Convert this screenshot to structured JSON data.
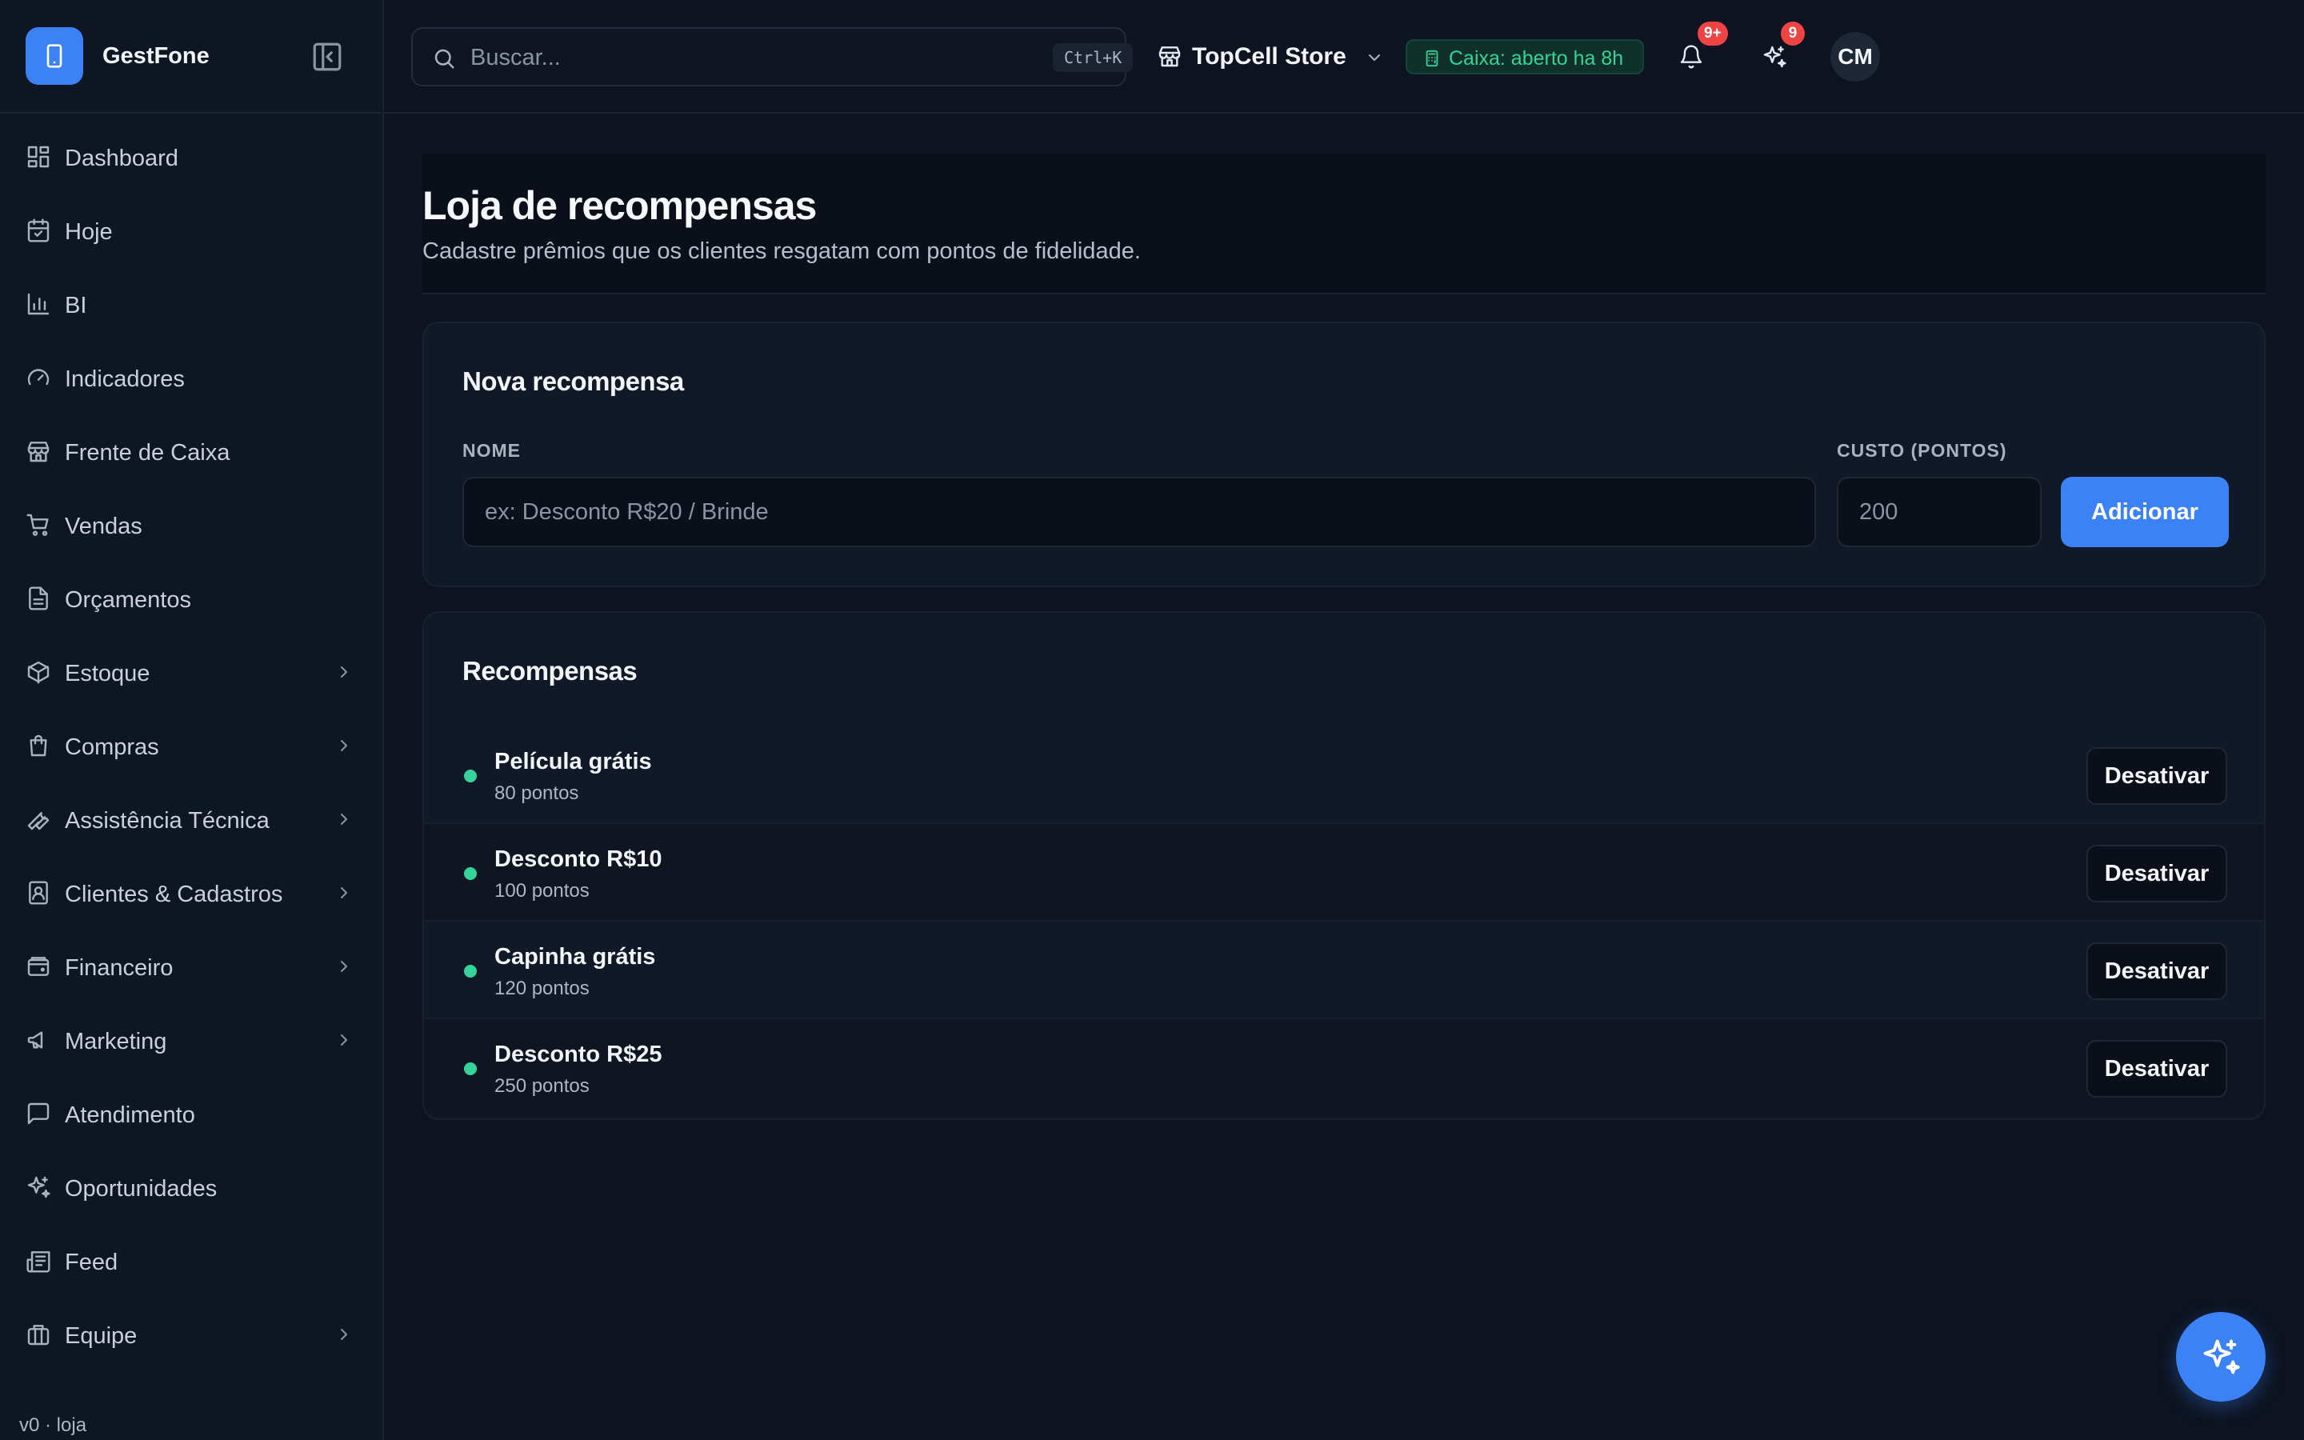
{
  "app": {
    "name": "GestFone",
    "version": "v0 · loja"
  },
  "sidebar": {
    "items": [
      {
        "label": "Dashboard",
        "icon": "dashboard-icon",
        "has_children": false
      },
      {
        "label": "Hoje",
        "icon": "calendar-icon",
        "has_children": false
      },
      {
        "label": "BI",
        "icon": "bar-chart-icon",
        "has_children": false
      },
      {
        "label": "Indicadores",
        "icon": "gauge-icon",
        "has_children": false
      },
      {
        "label": "Frente de Caixa",
        "icon": "store-icon",
        "has_children": false
      },
      {
        "label": "Vendas",
        "icon": "cart-icon",
        "has_children": false
      },
      {
        "label": "Orçamentos",
        "icon": "document-icon",
        "has_children": false
      },
      {
        "label": "Estoque",
        "icon": "package-icon",
        "has_children": true
      },
      {
        "label": "Compras",
        "icon": "shopping-bag-icon",
        "has_children": true
      },
      {
        "label": "Assistência Técnica",
        "icon": "wrench-icon",
        "has_children": true
      },
      {
        "label": "Clientes & Cadastros",
        "icon": "contact-book-icon",
        "has_children": true
      },
      {
        "label": "Financeiro",
        "icon": "wallet-icon",
        "has_children": true
      },
      {
        "label": "Marketing",
        "icon": "megaphone-icon",
        "has_children": true
      },
      {
        "label": "Atendimento",
        "icon": "chat-icon",
        "has_children": false
      },
      {
        "label": "Oportunidades",
        "icon": "sparkles-icon",
        "has_children": false
      },
      {
        "label": "Feed",
        "icon": "newspaper-icon",
        "has_children": false
      },
      {
        "label": "Equipe",
        "icon": "briefcase-icon",
        "has_children": true
      }
    ]
  },
  "topbar": {
    "search_placeholder": "Buscar...",
    "search_shortcut": "Ctrl+K",
    "store_name": "TopCell Store",
    "cash_status": "Caixa: aberto ha 8h",
    "notifications_badge": "9+",
    "ai_badge": "9",
    "user_initials": "CM"
  },
  "page": {
    "title": "Loja de recompensas",
    "subtitle": "Cadastre prêmios que os clientes resgatam com pontos de fidelidade."
  },
  "new_reward": {
    "title": "Nova recompensa",
    "name_label": "NOME",
    "name_placeholder": "ex: Desconto R$20 / Brinde",
    "cost_label": "CUSTO (PONTOS)",
    "cost_placeholder": "200",
    "add_button": "Adicionar"
  },
  "rewards": {
    "title": "Recompensas",
    "items": [
      {
        "name": "Película grátis",
        "cost": "80 pontos",
        "action": "Desativar",
        "active": true
      },
      {
        "name": "Desconto R$10",
        "cost": "100 pontos",
        "action": "Desativar",
        "active": true
      },
      {
        "name": "Capinha grátis",
        "cost": "120 pontos",
        "action": "Desativar",
        "active": true
      },
      {
        "name": "Desconto R$25",
        "cost": "250 pontos",
        "action": "Desativar",
        "active": true
      }
    ]
  },
  "colors": {
    "background": "#0d1320",
    "sidebar": "#0f1623",
    "card": "#111827",
    "accent": "#3b82f6",
    "success": "#34d399",
    "badge": "#ef4444"
  }
}
